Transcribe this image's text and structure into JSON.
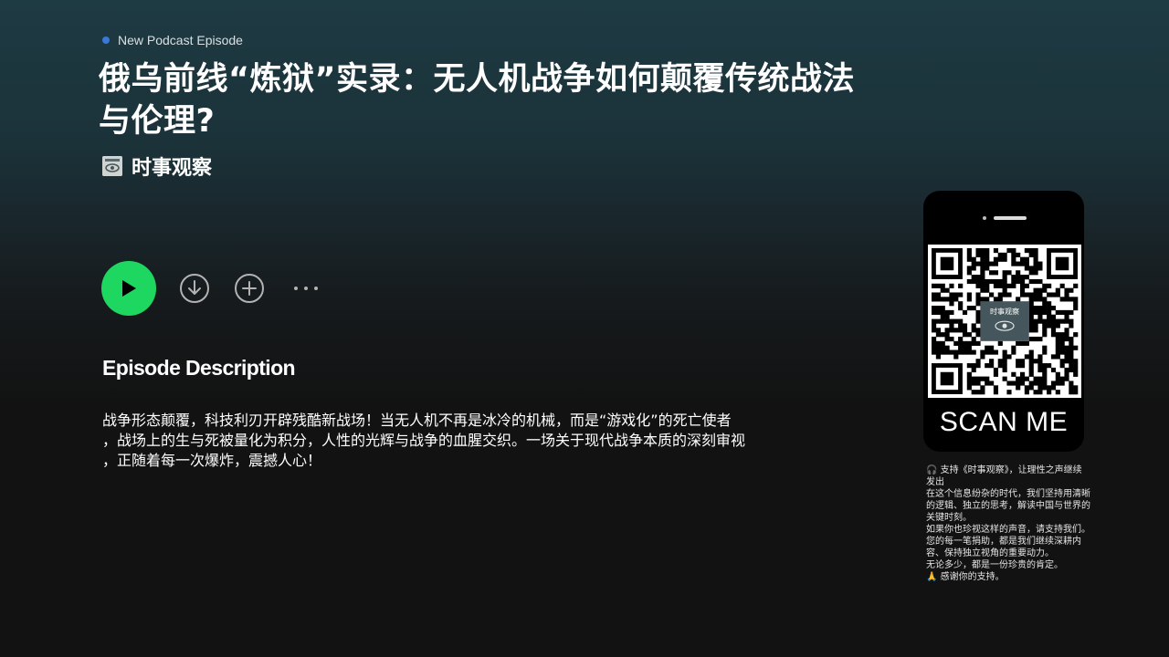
{
  "header": {
    "tag_label": "New Podcast Episode",
    "title": "俄乌前线“炼狱”实录：无人机战争如何颠覆传统战法与伦理?",
    "show_name": "时事观察",
    "show_cover_text": "时事观察"
  },
  "controls": {
    "play_icon": "play-icon",
    "download_icon": "download-icon",
    "add_icon": "add-icon",
    "more_icon": "more-icon"
  },
  "description": {
    "heading": "Episode Description",
    "lines": [
      "战争形态颠覆，科技利刃开辟残酷新战场！当无人机不再是冰冷的机械，而是“游戏化”的死亡使者",
      "，战场上的生与死被量化为积分，人性的光辉与战争的血腥交织。一场关于现代战争本质的深刻审视",
      "，正随着每一次爆炸，震撼人心！"
    ]
  },
  "sidebar": {
    "qr_center_label": "时事观察",
    "scan_label": "SCAN ME",
    "support_lines": [
      "🎧 支持《时事观察》，让理性之声继续发出",
      "在这个信息纷杂的时代，我们坚持用清晰的逻辑、独立的思考，解读中国与世界的关键时刻。",
      "如果你也珍视这样的声音，请支持我们。",
      "您的每一笔捐助，都是我们继续深耕内容、保持独立视角的重要动力。",
      "无论多少，都是一份珍贵的肯定。",
      "🙏 感谢你的支持。"
    ]
  },
  "colors": {
    "accent_green": "#1ed760",
    "tag_dot": "#3a78d6",
    "background_top": "#1e3a43",
    "background_bottom": "#121212"
  }
}
